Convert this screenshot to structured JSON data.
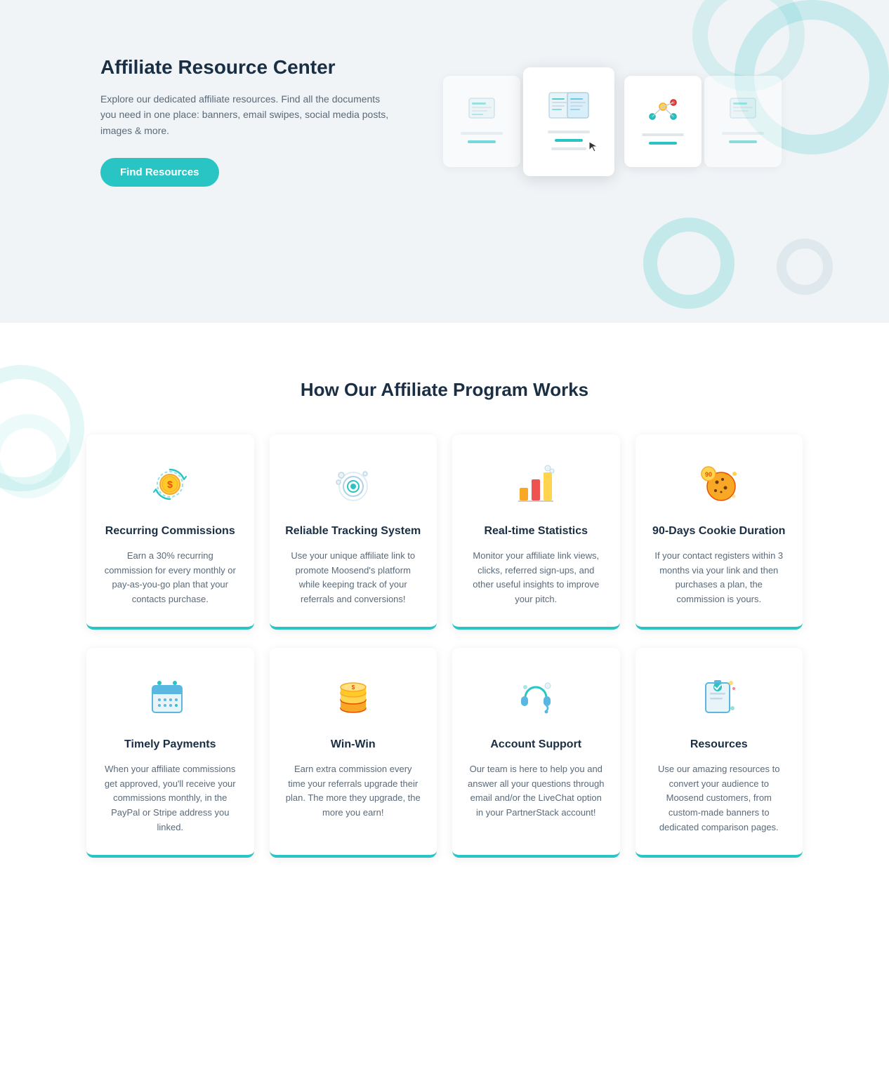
{
  "hero": {
    "title": "Affiliate Resource Center",
    "description": "Explore our dedicated affiliate resources. Find all the documents you need in one place: banners, email swipes, social media posts, images & more.",
    "button_label": "Find Resources"
  },
  "how_section": {
    "title": "How Our Affiliate Program Works",
    "cards": [
      {
        "id": "recurring",
        "title": "Recurring Commissions",
        "description": "Earn a 30% recurring commission for every monthly or pay-as-you-go plan that your contacts purchase.",
        "icon": "recurring-commissions-icon"
      },
      {
        "id": "tracking",
        "title": "Reliable Tracking System",
        "description": "Use your unique affiliate link to promote Moosend's platform while keeping track of your referrals and conversions!",
        "icon": "tracking-icon"
      },
      {
        "id": "stats",
        "title": "Real-time Statistics",
        "description": "Monitor your affiliate link views, clicks, referred sign-ups, and other useful insights to improve your pitch.",
        "icon": "stats-icon"
      },
      {
        "id": "cookie",
        "title": "90-Days Cookie Duration",
        "description": "If your contact registers within 3 months via your link and then purchases a plan, the commission is yours.",
        "icon": "cookie-icon"
      },
      {
        "id": "payments",
        "title": "Timely Payments",
        "description": "When your affiliate commissions get approved, you'll receive your commissions monthly, in the PayPal or Stripe address you linked.",
        "icon": "payments-icon"
      },
      {
        "id": "winwin",
        "title": "Win-Win",
        "description": "Earn extra commission every time your referrals upgrade their plan. The more they upgrade, the more you earn!",
        "icon": "winwin-icon"
      },
      {
        "id": "support",
        "title": "Account Support",
        "description": "Our team is here to help you and answer all your questions through email and/or the LiveChat option in your PartnerStack account!",
        "icon": "support-icon"
      },
      {
        "id": "resources",
        "title": "Resources",
        "description": "Use our amazing resources to convert your audience to Moosend customers, from custom-made banners to dedicated comparison pages.",
        "icon": "resources-icon"
      }
    ]
  }
}
